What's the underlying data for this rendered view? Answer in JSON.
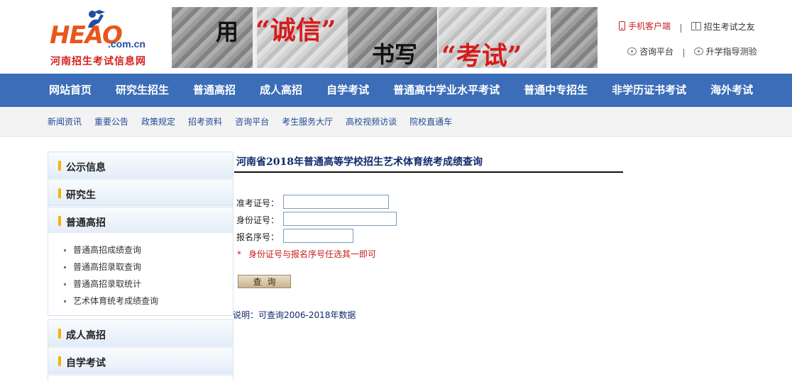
{
  "header": {
    "logo_text": "HEAO",
    "logo_domain": ".com.cn",
    "logo_cn": "河南招生考试信息网",
    "banner": {
      "text_yong": "用",
      "text_chengxin": "“诚信”",
      "text_shuxie": "书写",
      "text_kaoshi": "“考试”"
    },
    "links": {
      "mobile_client": "手机客户端",
      "exam_friend": "招生考试之友",
      "consult_platform": "咨询平台",
      "guidance_test": "升学指导测验"
    }
  },
  "main_nav": [
    "网站首页",
    "研究生招生",
    "普通高招",
    "成人高招",
    "自学考试",
    "普通高中学业水平考试",
    "普通中专招生",
    "非学历证书考试",
    "海外考试"
  ],
  "sub_nav": [
    "新闻资讯",
    "重要公告",
    "政策规定",
    "招考资料",
    "咨询平台",
    "考生服务大厅",
    "高校视频访谈",
    "院校直通车"
  ],
  "sidebar": {
    "sections": [
      {
        "title": "公示信息",
        "items": []
      },
      {
        "title": "研究生",
        "items": []
      },
      {
        "title": "普通高招",
        "items": [
          "普通高招成绩查询",
          "普通高招录取查询",
          "普通高招录取统计",
          "艺术体育统考成绩查询"
        ]
      },
      {
        "title": "成人高招",
        "items": []
      },
      {
        "title": "自学考试",
        "items": []
      }
    ]
  },
  "content": {
    "title": "河南省2018年普通高等学校招生艺术体育统考成绩查询",
    "fields": {
      "exam_no_label": "准考证号：",
      "exam_no_value": "",
      "id_no_label": "身份证号：",
      "id_no_value": "",
      "reg_no_label": "报名序号：",
      "reg_no_value": ""
    },
    "note_star": "*",
    "note_text": "身份证号与报名序号任选其一即可",
    "query_button": "查询",
    "description": "说明：可查询2006-2018年数据"
  },
  "colors": {
    "nav_bg": "#3b6db8",
    "subnav_link": "#1f4a96",
    "red": "#c81e1e",
    "sidebar_bar": "#f2b600"
  }
}
